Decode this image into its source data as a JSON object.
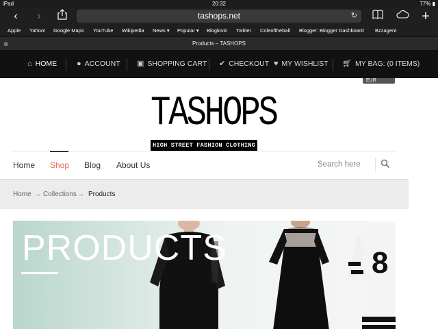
{
  "status_bar": {
    "device": "iPad",
    "time": "20:32",
    "battery": "77%"
  },
  "toolbar": {
    "url": "tashops.net",
    "back_icon": "back-arrow-icon",
    "forward_icon": "forward-arrow-icon",
    "share_icon": "share-icon",
    "bookmarks_icon": "book-icon",
    "cloud_icon": "cloud-icon",
    "add_icon": "plus-icon"
  },
  "bookmarks": [
    "Apple",
    "Yahoo!",
    "Google Maps",
    "YouTube",
    "Wikipedia",
    "News ▾",
    "Popular ▾",
    "Bloglovin",
    "Twitter",
    "Coleoftheball",
    "Blogger: Blogger Dashboard",
    "Bzzagent"
  ],
  "tab": {
    "title": "Products – TASHOPS"
  },
  "site_nav": {
    "home": "HOME",
    "account": "ACCOUNT",
    "cart": "SHOPPING CART",
    "checkout": "CHECKOUT",
    "wishlist": "MY WISHLIST",
    "bag": "MY BAG: (0 ITEMS)"
  },
  "currency": "EUR",
  "logo": {
    "main": "TASHOPS",
    "sub": "HIGH STREET FASHION CLOTHING"
  },
  "main_menu": {
    "home": "Home",
    "shop": "Shop",
    "blog": "Blog",
    "about": "About Us",
    "search_placeholder": "Search here"
  },
  "breadcrumb": {
    "home": "Home",
    "collections": "Collections",
    "current": "Products",
    "sep": "→"
  },
  "hero": {
    "title": "PRODUCTS"
  },
  "colors": {
    "nav_bg": "#111111",
    "accent": "#e0685a"
  }
}
